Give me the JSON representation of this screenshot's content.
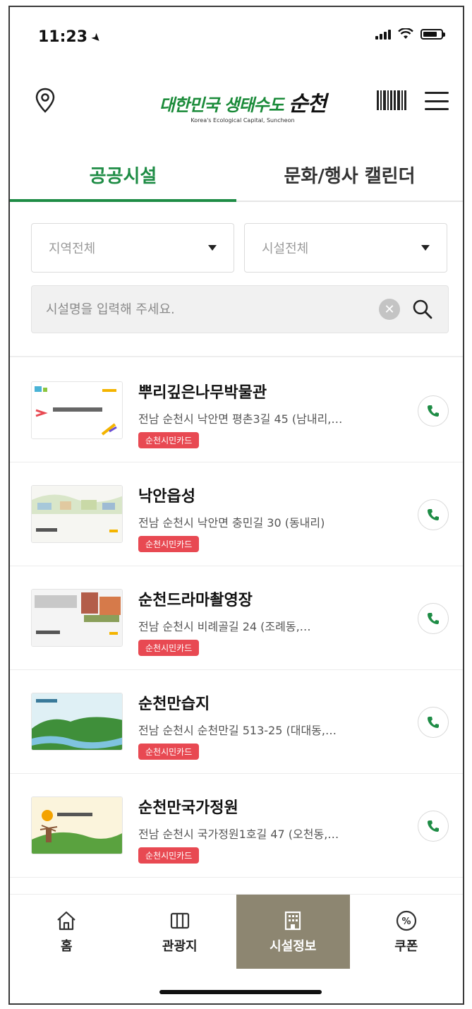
{
  "status": {
    "time": "11:23"
  },
  "header": {
    "logo_text": "대한민국 생태수도",
    "logo_highlight": "순천",
    "logo_sub": "Korea's Ecological Capital, Suncheon"
  },
  "tabs": [
    {
      "label": "공공시설",
      "active": true
    },
    {
      "label": "문화/행사 캘린더",
      "active": false
    }
  ],
  "filters": {
    "region": "지역전체",
    "facility": "시설전체"
  },
  "search": {
    "placeholder": "시설명을 입력해 주세요."
  },
  "items": [
    {
      "name": "뿌리깊은나무박물관",
      "address": "전남 순천시 낙안면 평촌3길 45 (남내리,…",
      "badge": "순천시민카드"
    },
    {
      "name": "낙안읍성",
      "address": "전남 순천시 낙안면 충민길 30 (동내리)",
      "badge": "순천시민카드"
    },
    {
      "name": "순천드라마촬영장",
      "address": "전남 순천시 비례골길 24 (조례동,…",
      "badge": "순천시민카드"
    },
    {
      "name": "순천만습지",
      "address": "전남 순천시 순천만길 513-25 (대대동,…",
      "badge": "순천시민카드"
    },
    {
      "name": "순천만국가정원",
      "address": "전남 순천시 국가정원1호길 47 (오천동,…",
      "badge": "순천시민카드"
    }
  ],
  "nav": [
    {
      "label": "홈",
      "icon": "home-icon"
    },
    {
      "label": "관광지",
      "icon": "map-icon"
    },
    {
      "label": "시설정보",
      "icon": "building-icon",
      "active": true
    },
    {
      "label": "쿠폰",
      "icon": "coupon-icon"
    }
  ],
  "colors": {
    "accent": "#1e8c45",
    "badge": "#e84952",
    "nav_active": "#8d8671"
  }
}
